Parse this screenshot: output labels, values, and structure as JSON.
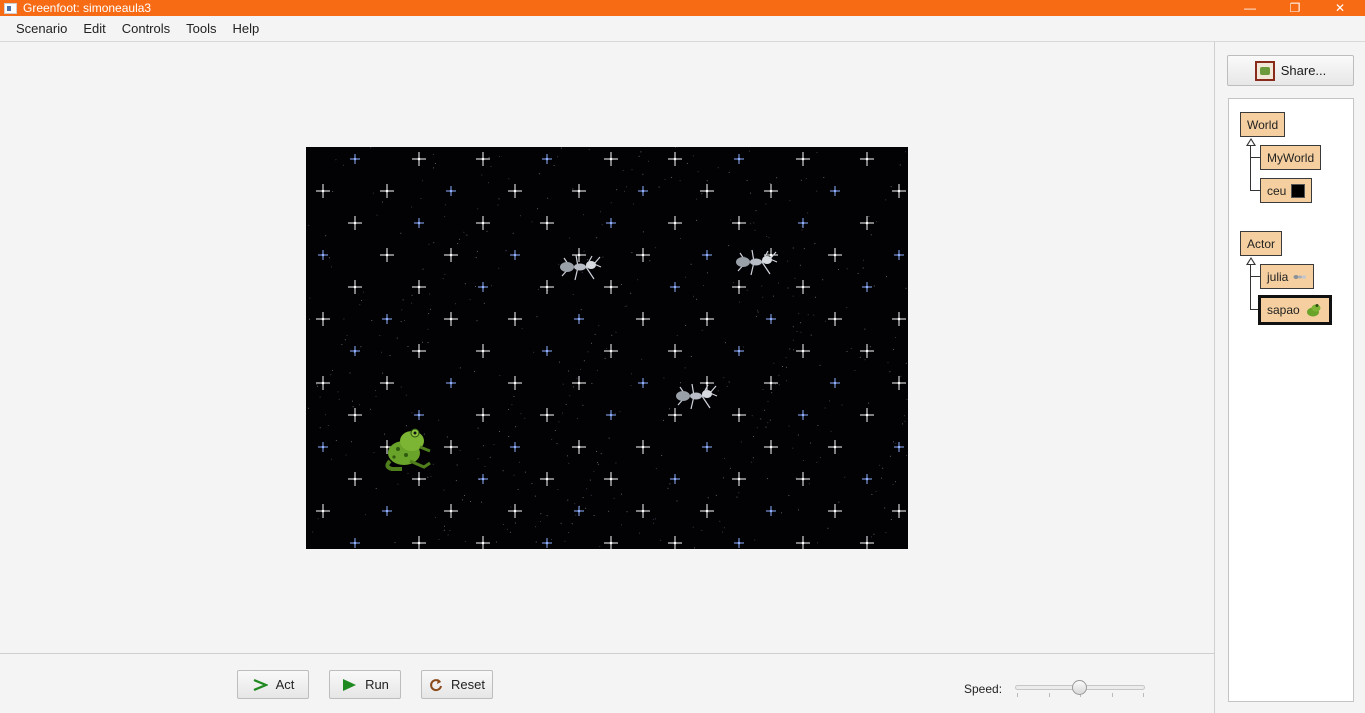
{
  "window": {
    "title": "Greenfoot: simoneaula3",
    "minimize_glyph": "—",
    "maximize_glyph": "❐",
    "close_glyph": "✕"
  },
  "menu": [
    "Scenario",
    "Edit",
    "Controls",
    "Tools",
    "Help"
  ],
  "world": {
    "background": "starfield",
    "actors": [
      {
        "type": "julia",
        "icon": "ant-icon"
      },
      {
        "type": "julia",
        "icon": "ant-icon"
      },
      {
        "type": "julia",
        "icon": "ant-icon"
      },
      {
        "type": "sapao",
        "icon": "frog-icon"
      }
    ]
  },
  "controls": {
    "act_label": "Act",
    "run_label": "Run",
    "reset_label": "Reset",
    "speed_label": "Speed:",
    "speed_value": 0.5
  },
  "sidebar": {
    "share_label": "Share...",
    "world_classes": {
      "root": "World",
      "children": [
        "MyWorld",
        "ceu"
      ]
    },
    "actor_classes": {
      "root": "Actor",
      "children": [
        "julia",
        "sapao"
      ],
      "selected": "sapao"
    }
  },
  "colors": {
    "titlebar": "#f76b15",
    "class_box": "#f5cf9f",
    "play_green": "#1f8a1f"
  }
}
